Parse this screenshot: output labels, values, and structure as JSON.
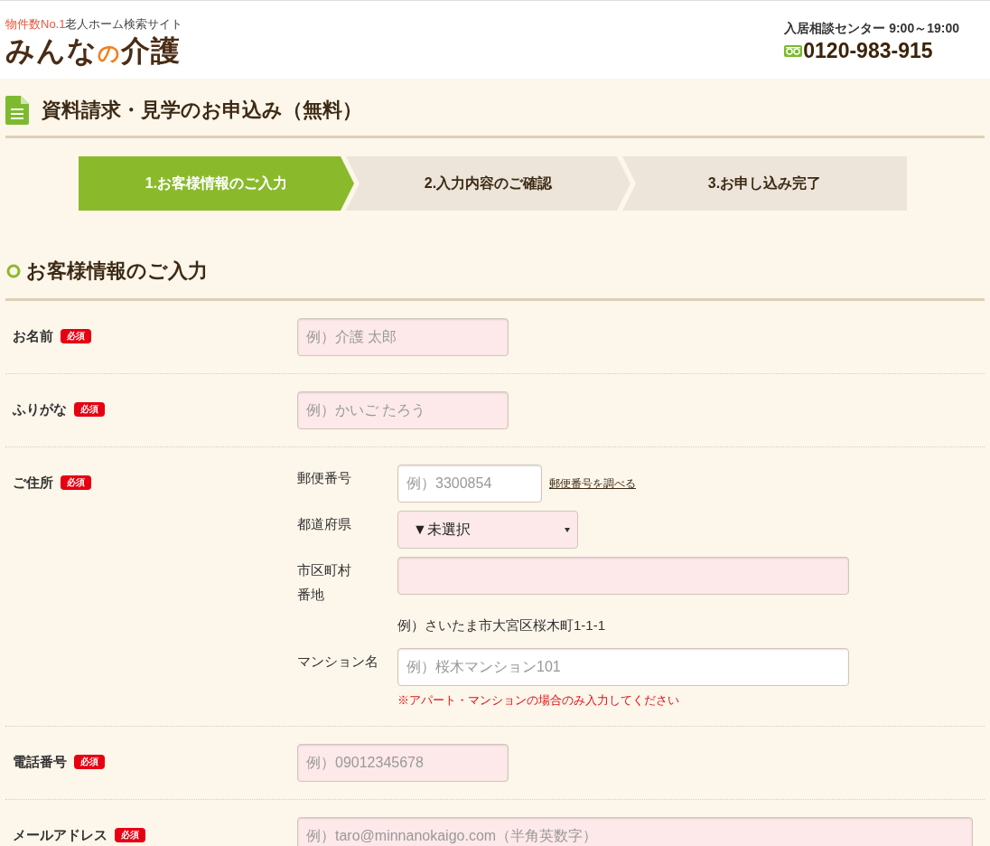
{
  "header": {
    "tagline_highlight": "物件数No.1",
    "tagline": "老人ホーム検索サイト",
    "logo": [
      "みんな",
      "の",
      "介護"
    ],
    "contact_label": "入居相談センター 9:00～19:00",
    "phone": "0120-983-915"
  },
  "page_title": "資料請求・見学のお申込み（無料）",
  "steps": [
    {
      "label": "1.お客様情報のご入力",
      "selected": true
    },
    {
      "label": "2.入力内容のご確認",
      "selected": false
    },
    {
      "label": "3.お申し込み完了",
      "selected": false
    }
  ],
  "section_title": "お客様情報のご入力",
  "fields": [
    {
      "kind": "text",
      "label": "お名前",
      "badge": "必須",
      "placeholder": "例）介護 太郎",
      "required": true
    },
    {
      "kind": "text",
      "label": "ふりがな",
      "badge": "必須",
      "placeholder": "例）かいご たろう",
      "required": true
    },
    {
      "kind": "address",
      "label": "ご住所",
      "badge": "必須",
      "parts": [
        {
          "kind": "postal",
          "label_lines": [
            "郵便番号"
          ],
          "placeholder": "例）3300854",
          "required": false,
          "link": "郵便番号を調べる"
        },
        {
          "kind": "select",
          "label_lines": [
            "都道府県"
          ],
          "value": "▼未選択",
          "required": true
        },
        {
          "kind": "input",
          "label_lines": [
            "市区町村",
            "番地"
          ],
          "required": true,
          "hint": "例）さいたま市大宮区桜木町1-1-1"
        },
        {
          "kind": "input",
          "label_lines": [
            "マンション名"
          ],
          "placeholder": "例）桜木マンション101",
          "required": false,
          "note": "※アパート・マンションの場合のみ入力してください"
        }
      ]
    },
    {
      "kind": "text",
      "label": "電話番号",
      "badge": "必須",
      "placeholder": "例）09012345678",
      "required": true
    },
    {
      "kind": "wide",
      "label": "メールアドレス",
      "badge": "必須",
      "placeholder": "例）taro@minnanokaigo.com（半角英数字）",
      "required": true
    }
  ]
}
